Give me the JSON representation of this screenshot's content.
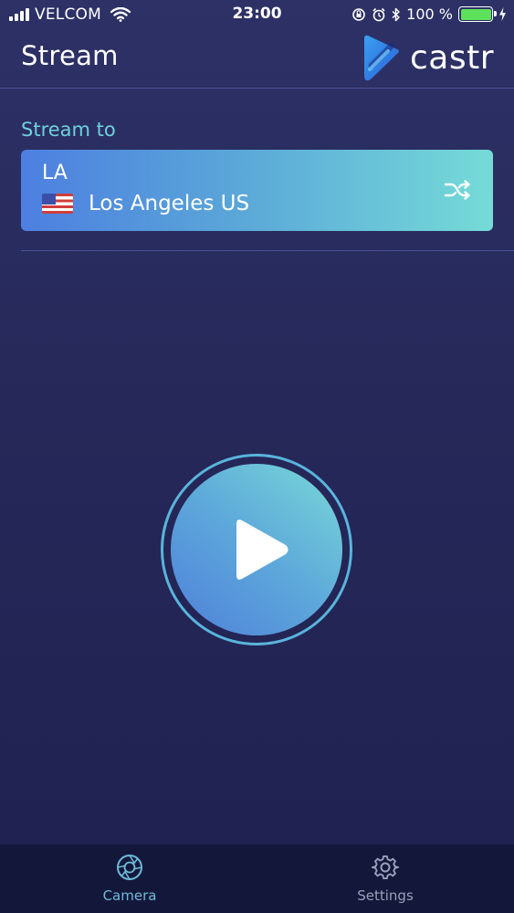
{
  "status_bar": {
    "carrier": "VELCOM",
    "time": "23:00",
    "battery": "100 %"
  },
  "header": {
    "title": "Stream",
    "logo_text": "castr"
  },
  "stream_to": {
    "label": "Stream to",
    "server_name": "LA",
    "location": "Los Angeles US"
  },
  "tabs": [
    {
      "label": "Camera",
      "icon": "camera-aperture-icon",
      "active": true
    },
    {
      "label": "Settings",
      "icon": "gear-icon",
      "active": false
    }
  ],
  "colors": {
    "background": "#262859",
    "accent": "#6fd0dc",
    "battery": "#5de15b"
  }
}
